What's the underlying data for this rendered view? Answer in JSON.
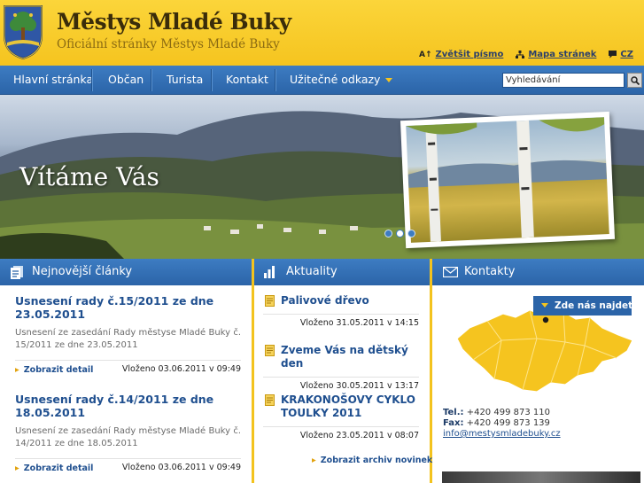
{
  "header": {
    "title": "Městys Mladé Buky",
    "subtitle": "Oficiální stránky Městys Mladé Buky",
    "toolbar": {
      "font_size": "Zvětšit písmo",
      "font_icon": "A↑",
      "sitemap": "Mapa stránek",
      "language": "CZ"
    }
  },
  "nav": {
    "items": [
      "Hlavní stránka",
      "Občan",
      "Turista",
      "Kontakt",
      "Užitečné odkazy"
    ],
    "search_placeholder": "Vyhledávání"
  },
  "hero": {
    "title": "Vítáme Vás",
    "slides_count": 3,
    "active_slide": 1
  },
  "articles": {
    "heading": "Nejnovější články",
    "items": [
      {
        "title": "Usnesení rady č.15/2011 ze dne 23.05.2011",
        "perex": "Usnesení ze zasedání Rady městyse Mladé Buky č. 15/2011 ze dne 23.05.2011",
        "more": "Zobrazit detail",
        "posted": "Vloženo 03.06.2011 v 09:49"
      },
      {
        "title": "Usnesení rady č.14/2011 ze dne 18.05.2011",
        "perex": "Usnesení ze zasedání Rady městyse Mladé Buky č. 14/2011 ze dne 18.05.2011",
        "more": "Zobrazit detail",
        "posted": "Vloženo 03.06.2011 v 09:49"
      }
    ]
  },
  "news": {
    "heading": "Aktuality",
    "items": [
      {
        "title": "Palivové dřevo",
        "posted": "Vloženo 31.05.2011 v 14:15"
      },
      {
        "title": "Zveme Vás na dětský den",
        "posted": "Vloženo 30.05.2011 v 13:17"
      },
      {
        "title": "KRAKONOŠOVY CYKLO TOULKY 2011",
        "posted": "Vloženo 23.05.2011 v 08:07"
      }
    ],
    "archive": "Zobrazit archiv novinek"
  },
  "contacts": {
    "heading": "Kontakty",
    "find_us": "Zde nás najdete",
    "tel_label": "Tel.:",
    "tel": "+420 499 873 110",
    "fax_label": "Fax:",
    "fax": "+420 499 873 139",
    "email": "info@mestysmladebuky.cz"
  },
  "colors": {
    "brand_yellow": "#f5c41f",
    "nav_blue": "#2b64a8",
    "link_blue": "#1f4f8f"
  }
}
